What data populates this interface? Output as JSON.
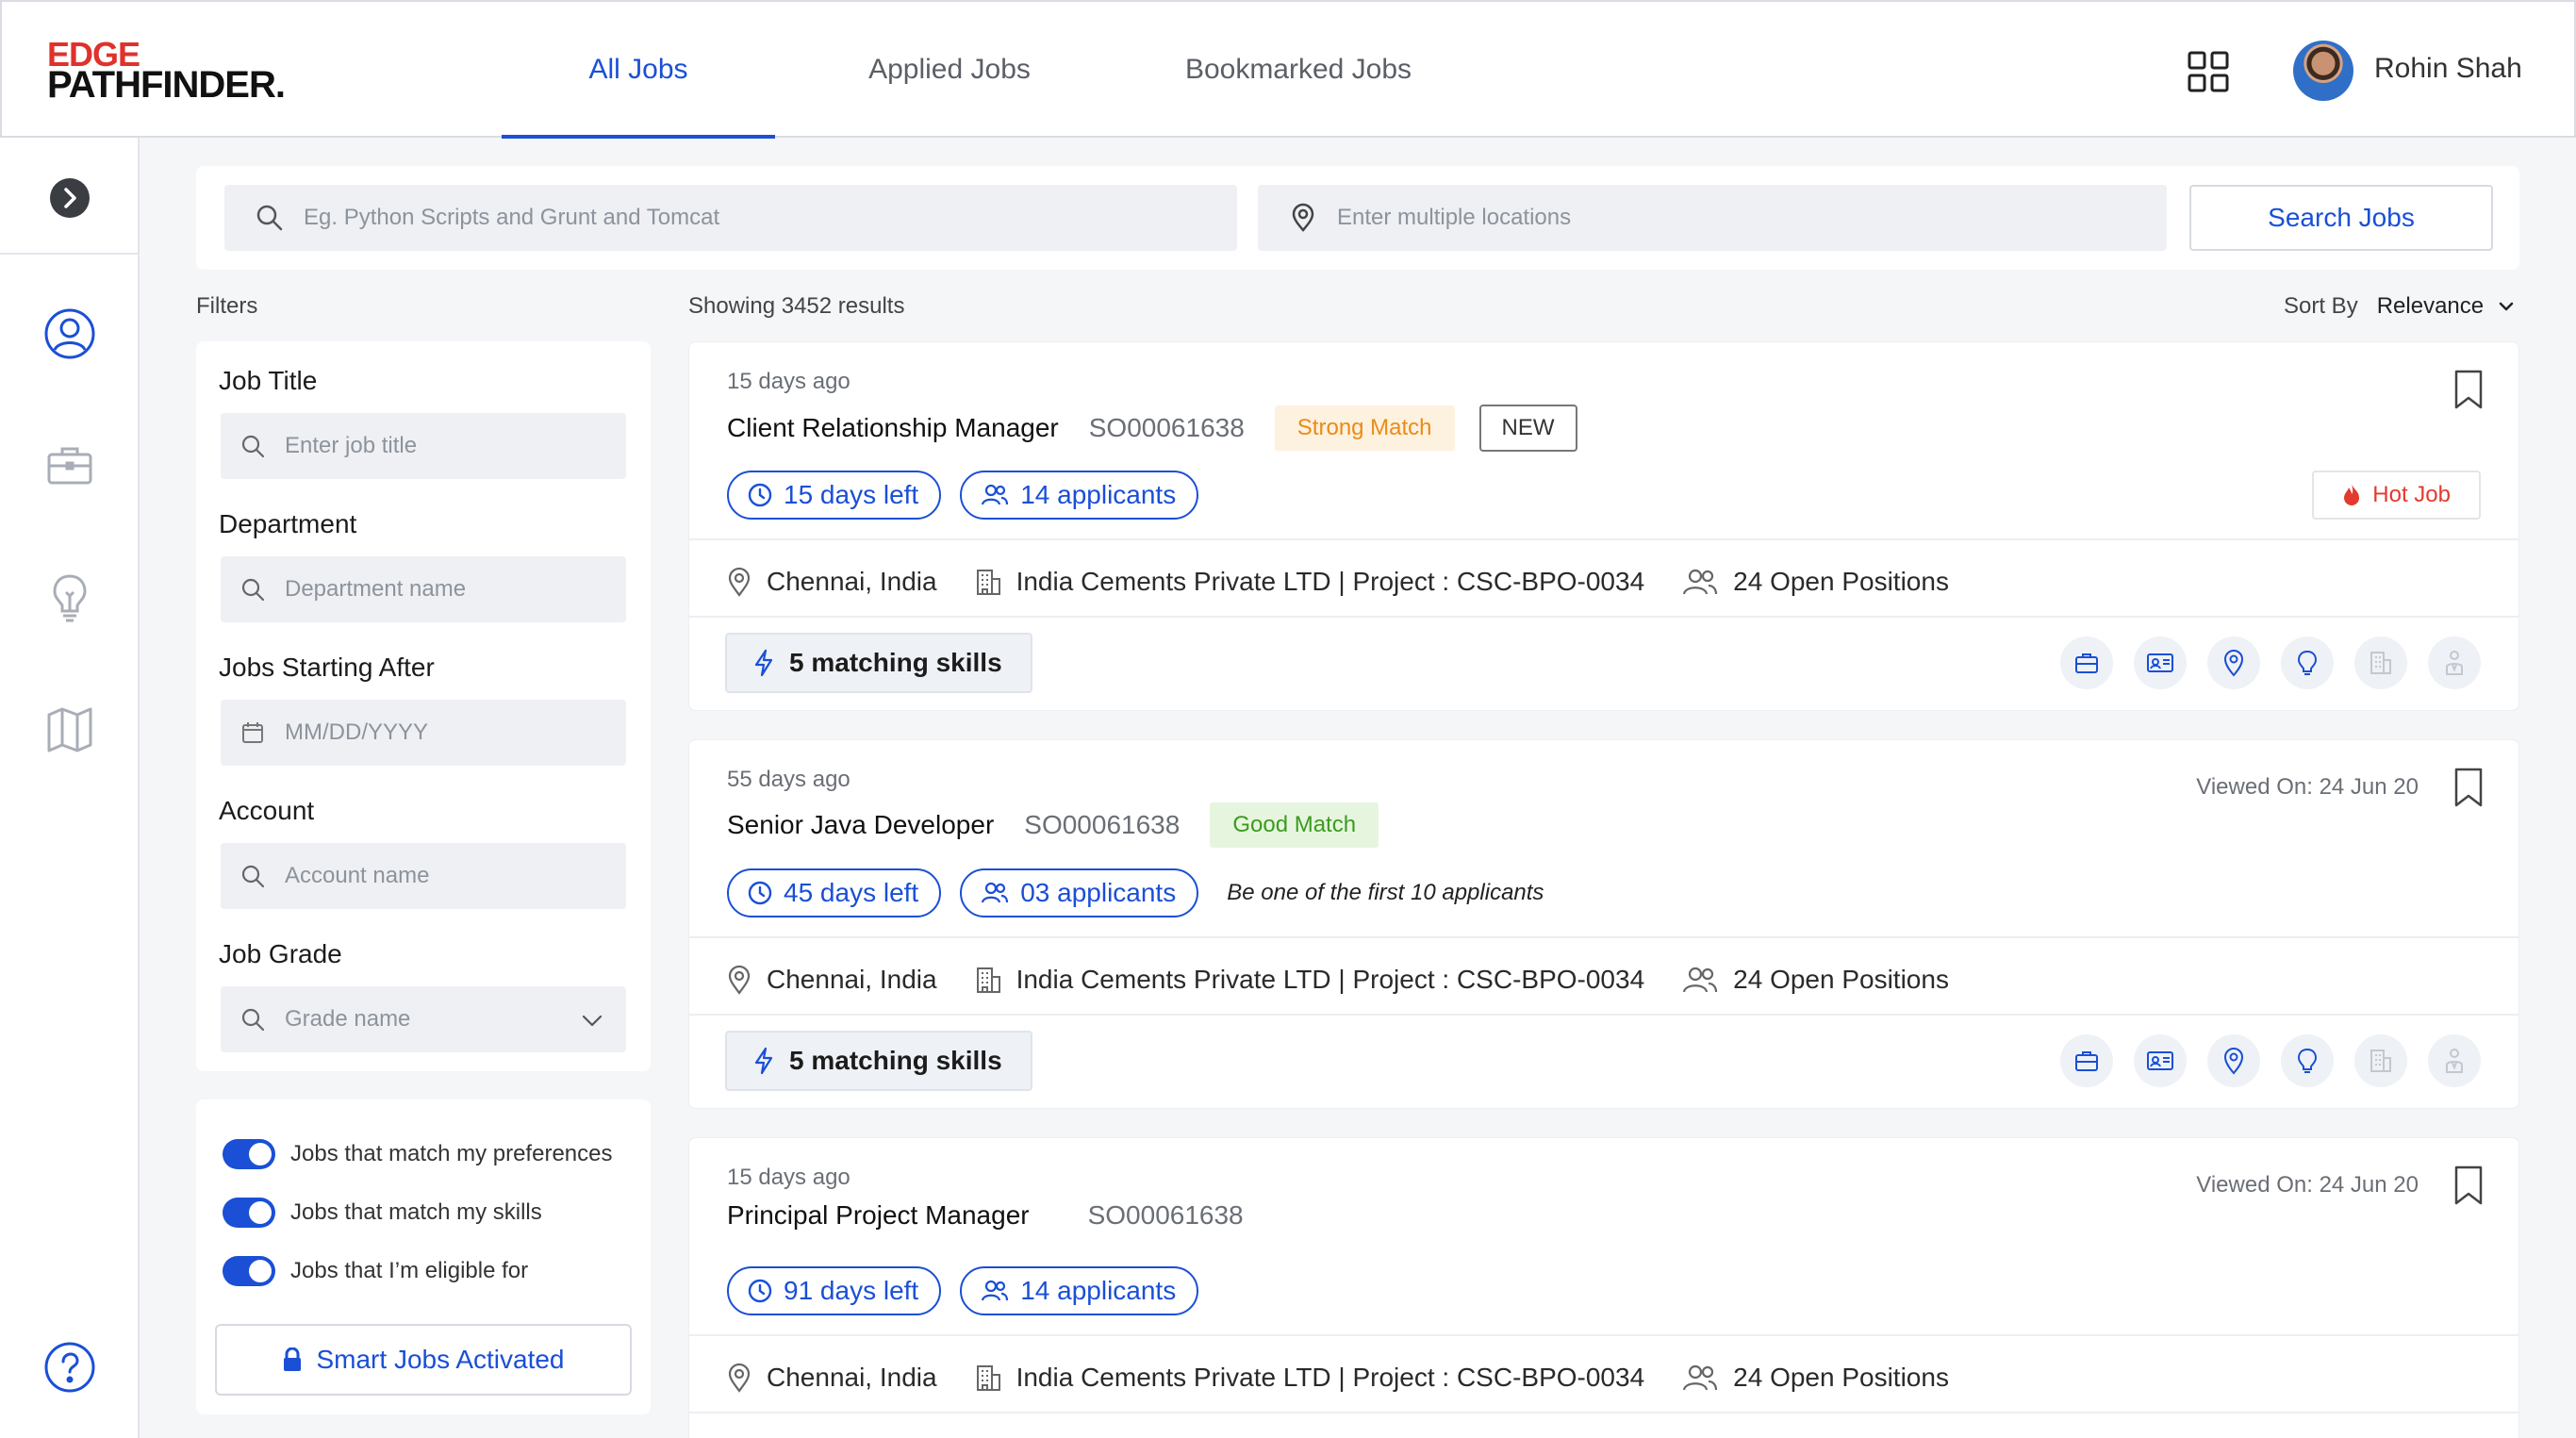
{
  "brand": {
    "line1": "EDGE",
    "line2": "PATHFINDER."
  },
  "nav": {
    "tabs": [
      {
        "label": "All Jobs",
        "active": true
      },
      {
        "label": "Applied Jobs",
        "active": false
      },
      {
        "label": "Bookmarked Jobs",
        "active": false
      }
    ]
  },
  "user": {
    "name": "Rohin Shah"
  },
  "search": {
    "keyword_placeholder": "Eg. Python Scripts and Grunt and Tomcat",
    "location_placeholder": "Enter multiple locations",
    "button_label": "Search Jobs"
  },
  "filters": {
    "heading": "Filters",
    "job_title": {
      "label": "Job Title",
      "placeholder": "Enter job title"
    },
    "department": {
      "label": "Department",
      "placeholder": "Department name"
    },
    "start_after": {
      "label": "Jobs Starting After",
      "placeholder": "MM/DD/YYYY"
    },
    "account": {
      "label": "Account",
      "placeholder": "Account name"
    },
    "grade": {
      "label": "Job Grade",
      "placeholder": "Grade name"
    },
    "toggles": [
      {
        "label": "Jobs that match my preferences",
        "on": true
      },
      {
        "label": "Jobs that match my skills",
        "on": true
      },
      {
        "label": "Jobs that I’m eligible for",
        "on": true
      }
    ],
    "smart_button": "Smart Jobs Activated"
  },
  "results": {
    "count_text": "Showing 3452 results",
    "sort_label": "Sort By",
    "sort_value": "Relevance"
  },
  "colors": {
    "accent": "#1a4fd6",
    "strong_match": "#ec8b13",
    "good_match": "#3d9a20",
    "hot": "#e23a2f"
  },
  "jobs": [
    {
      "posted": "15 days ago",
      "title": "Client Relationship Manager",
      "code": "SO00061638",
      "match": "Strong Match",
      "new_label": "NEW",
      "days_left": "15 days left",
      "applicants": "14 applicants",
      "hot_label": "Hot Job",
      "location": "Chennai, India",
      "company": "India Cements Private LTD | Project : CSC-BPO-0034",
      "positions": "24 Open Positions",
      "skills": "5 matching skills"
    },
    {
      "posted": "55 days ago",
      "title": "Senior Java Developer",
      "code": "SO00061638",
      "match": "Good Match",
      "viewed": "Viewed On: 24 Jun 20",
      "days_left": "45 days left",
      "applicants": "03 applicants",
      "note": "Be one of the first 10 applicants",
      "location": "Chennai, India",
      "company": "India Cements Private LTD | Project : CSC-BPO-0034",
      "positions": "24 Open Positions",
      "skills": "5 matching skills"
    },
    {
      "posted": "15 days ago",
      "title": "Principal Project Manager",
      "code": "SO00061638",
      "viewed": "Viewed On: 24 Jun 20",
      "days_left": "91 days left",
      "applicants": "14 applicants",
      "location": "Chennai, India",
      "company": "India Cements Private LTD | Project : CSC-BPO-0034",
      "positions": "24 Open Positions"
    }
  ]
}
